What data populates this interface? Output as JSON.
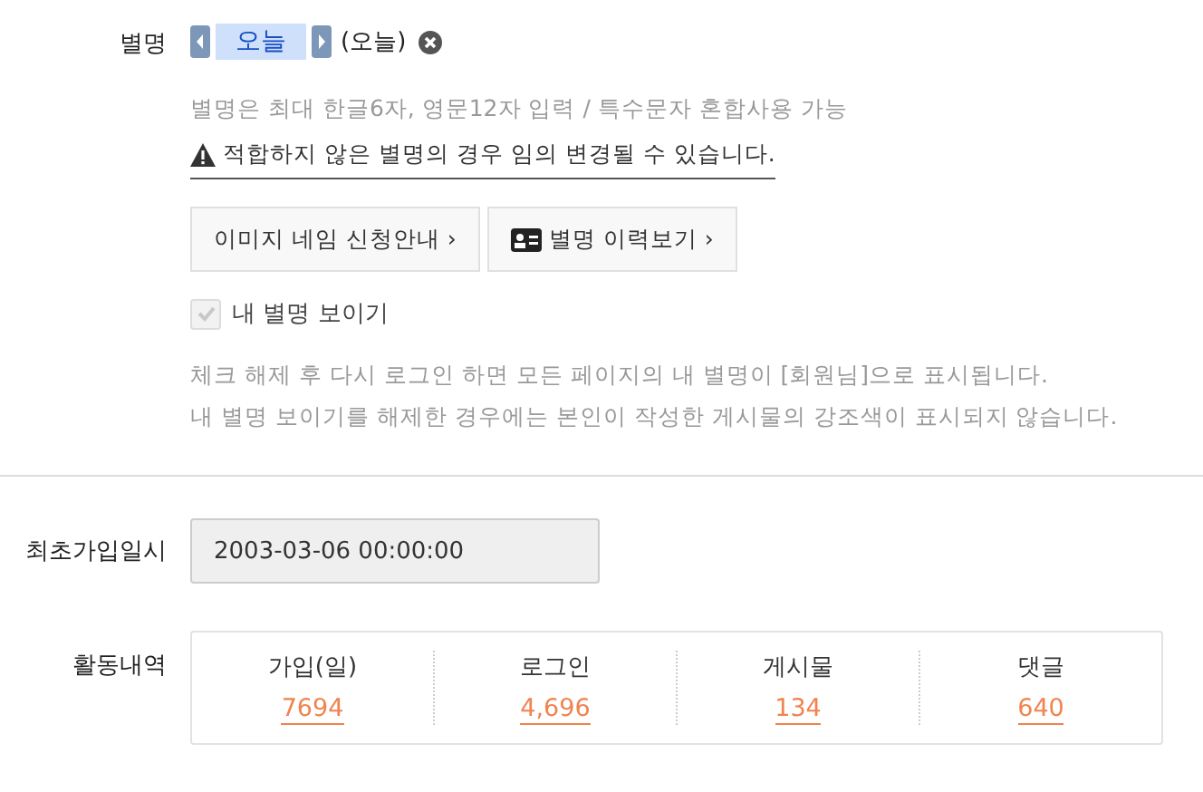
{
  "nickname": {
    "label": "별명",
    "name": "오늘",
    "original": "(오늘)",
    "hint": "별명은 최대 한글6자, 영문12자 입력 / 특수문자 혼합사용 가능",
    "warning": "적합하지 않은 별명의 경우 임의 변경될 수 있습니다."
  },
  "buttons": [
    {
      "label": "이미지 네임 신청안내 ›",
      "kind": "plain"
    },
    {
      "label": "별명 이력보기 ›",
      "kind": "card"
    }
  ],
  "show_nickname": {
    "label": "내 별명 보이기",
    "checked": true,
    "disabled": true
  },
  "notes": [
    "체크 해제 후 다시 로그인 하면 모든 페이지의 내 별명이 [회원님]으로 표시됩니다.",
    "내 별명 보이기를 해제한 경우에는 본인이 작성한 게시물의 강조색이 표시되지 않습니다."
  ],
  "join_date": {
    "label": "최초가입일시",
    "value": "2003-03-06 00:00:00"
  },
  "activity": {
    "label": "활동내역",
    "stats": [
      {
        "title": "가입(일)",
        "value": "7694"
      },
      {
        "title": "로그인",
        "value": "4,696"
      },
      {
        "title": "게시물",
        "value": "134"
      },
      {
        "title": "댓글",
        "value": "640"
      }
    ]
  }
}
